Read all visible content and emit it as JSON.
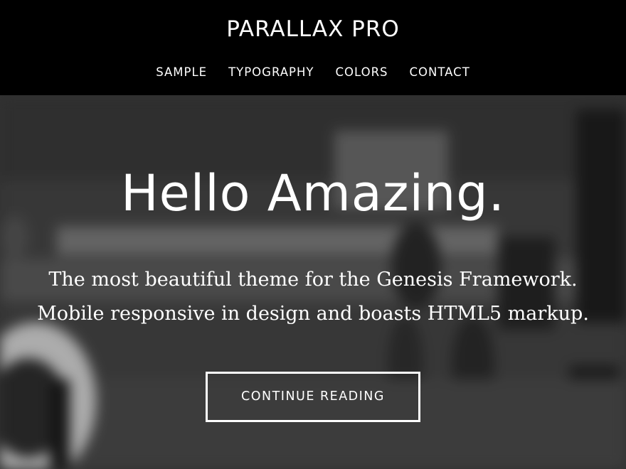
{
  "header": {
    "site_title": "PARALLAX PRO",
    "nav": [
      {
        "label": "SAMPLE"
      },
      {
        "label": "TYPOGRAPHY"
      },
      {
        "label": "COLORS"
      },
      {
        "label": "CONTACT"
      }
    ]
  },
  "hero": {
    "title": "Hello Amazing.",
    "description_lines": [
      "The most beautiful theme for the Genesis Framework.",
      "Mobile responsive in design and boasts HTML5 markup."
    ],
    "button_label": "CONTINUE READING"
  },
  "colors": {
    "header_bg": "#000000",
    "text": "#ffffff",
    "hero_overlay": "#3d3d3d"
  }
}
